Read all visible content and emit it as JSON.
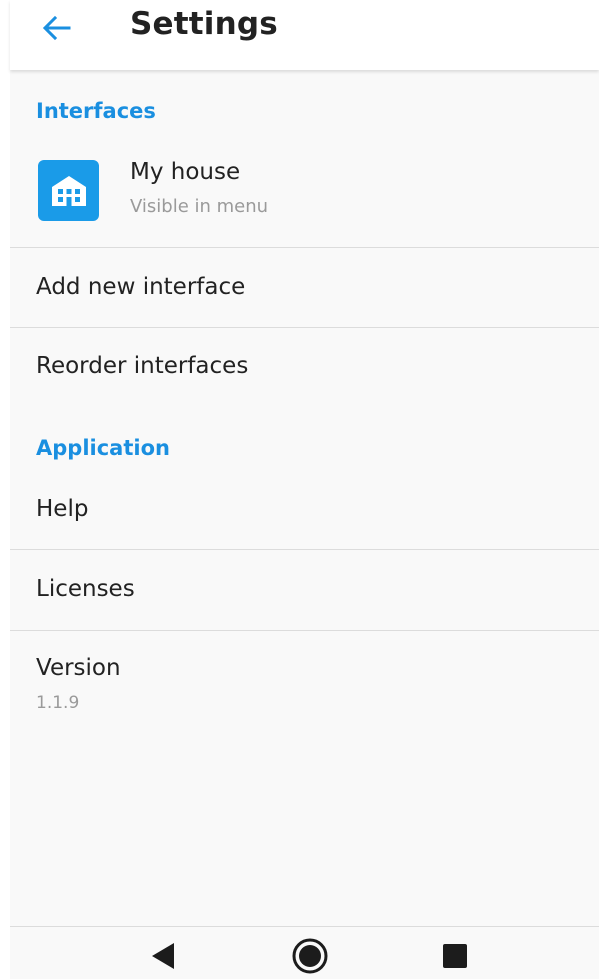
{
  "appbar": {
    "title": "Settings",
    "back_icon": "arrow-left-icon"
  },
  "sections": {
    "interfaces": {
      "header": "Interfaces",
      "item": {
        "icon": "house-icon",
        "title": "My house",
        "subtitle": "Visible in menu"
      },
      "add_label": "Add new interface",
      "reorder_label": "Reorder interfaces"
    },
    "application": {
      "header": "Application",
      "help_label": "Help",
      "licenses_label": "Licenses",
      "version_label": "Version",
      "version_value": "1.1.9"
    }
  },
  "navbar": {
    "back_icon": "triangle-back-icon",
    "home_icon": "circle-home-icon",
    "recents_icon": "square-recents-icon"
  },
  "colors": {
    "accent": "#1a8fe0",
    "icon_bg": "#1a9be8",
    "text_primary": "#222222",
    "text_secondary": "#9a9a9a",
    "background": "#f9f9f9"
  }
}
